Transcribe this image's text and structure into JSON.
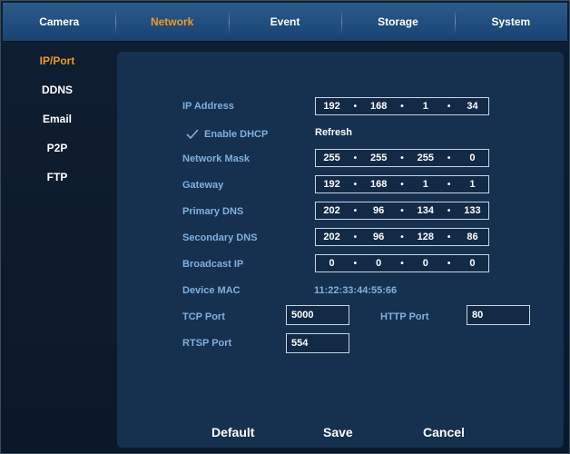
{
  "tabs": [
    "Camera",
    "Network",
    "Event",
    "Storage",
    "System"
  ],
  "active_tab": "Network",
  "side_menu": [
    "IP/Port",
    "DDNS",
    "Email",
    "P2P",
    "FTP"
  ],
  "active_side_item": "IP/Port",
  "colors": {
    "accent": "#f39a1a",
    "label": "#7fb0de",
    "panel": "#16304f"
  },
  "fields": {
    "ip_address": {
      "label": "IP Address",
      "octets": [
        "192",
        "168",
        "1",
        "34"
      ]
    },
    "dhcp": {
      "label": "Enable DHCP",
      "checked": true,
      "refresh_label": "Refresh"
    },
    "network_mask": {
      "label": "Network Mask",
      "octets": [
        "255",
        "255",
        "255",
        "0"
      ]
    },
    "gateway": {
      "label": "Gateway",
      "octets": [
        "192",
        "168",
        "1",
        "1"
      ]
    },
    "primary_dns": {
      "label": "Primary DNS",
      "octets": [
        "202",
        "96",
        "134",
        "133"
      ]
    },
    "secondary_dns": {
      "label": "Secondary DNS",
      "octets": [
        "202",
        "96",
        "128",
        "86"
      ]
    },
    "broadcast_ip": {
      "label": "Broadcast IP",
      "octets": [
        "0",
        "0",
        "0",
        "0"
      ]
    },
    "device_mac": {
      "label": "Device MAC",
      "value": "11:22:33:44:55:66"
    },
    "tcp_port": {
      "label": "TCP Port",
      "value": "5000"
    },
    "http_port": {
      "label": "HTTP Port",
      "value": "80"
    },
    "rtsp_port": {
      "label": "RTSP Port",
      "value": "554"
    }
  },
  "buttons": {
    "default": "Default",
    "save": "Save",
    "cancel": "Cancel"
  },
  "separator_glyph": "•"
}
